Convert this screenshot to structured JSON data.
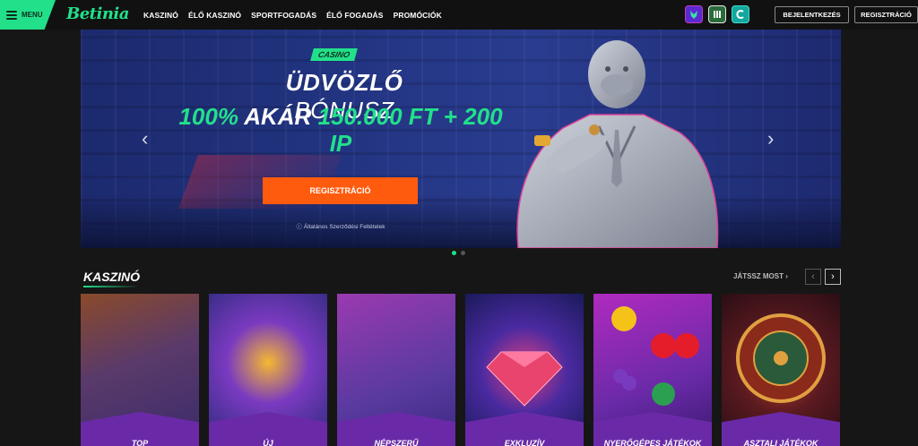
{
  "header": {
    "menu_label": "MENU",
    "logo_text": "Betinia",
    "nav": [
      "KASZINÓ",
      "ÉLŐ KASZINÓ",
      "SPORTFOGADÁS",
      "ÉLŐ FOGADÁS",
      "PROMÓCIÓK"
    ],
    "badge_icons": [
      "wolf-emblem-icon",
      "stadium-emblem-icon",
      "cyan-c-emblem-icon"
    ],
    "login_label": "BEJELENTKEZÉS",
    "register_label": "REGISZTRÁCIÓ"
  },
  "hero": {
    "tag": "CASINO",
    "title_bold": "ÜDVÖZLŐ",
    "title_light": "BÓNUSZ",
    "offer_green_1": "100%",
    "offer_white": "AKÁR",
    "offer_green_2": "150.000 FT + 200 IP",
    "cta_label": "REGISZTRÁCIÓ",
    "terms": "ⓘ Általános Szerződési Feltételek",
    "slide_count": 2,
    "active_slide": 1
  },
  "casino_section": {
    "title": "KASZINÓ",
    "play_now": "JÁTSSZ MOST",
    "cards": [
      {
        "label": "TOP"
      },
      {
        "label": "ÚJ"
      },
      {
        "label": "NÉPSZERŰ"
      },
      {
        "label": "EXKLUZÍV"
      },
      {
        "label": "NYERŐGÉPES JÁTÉKOK"
      },
      {
        "label": "ASZTALI JÁTÉKOK"
      }
    ]
  },
  "colors": {
    "accent_green": "#22e08a",
    "cta_orange": "#ff5b0e",
    "background": "#161616"
  }
}
